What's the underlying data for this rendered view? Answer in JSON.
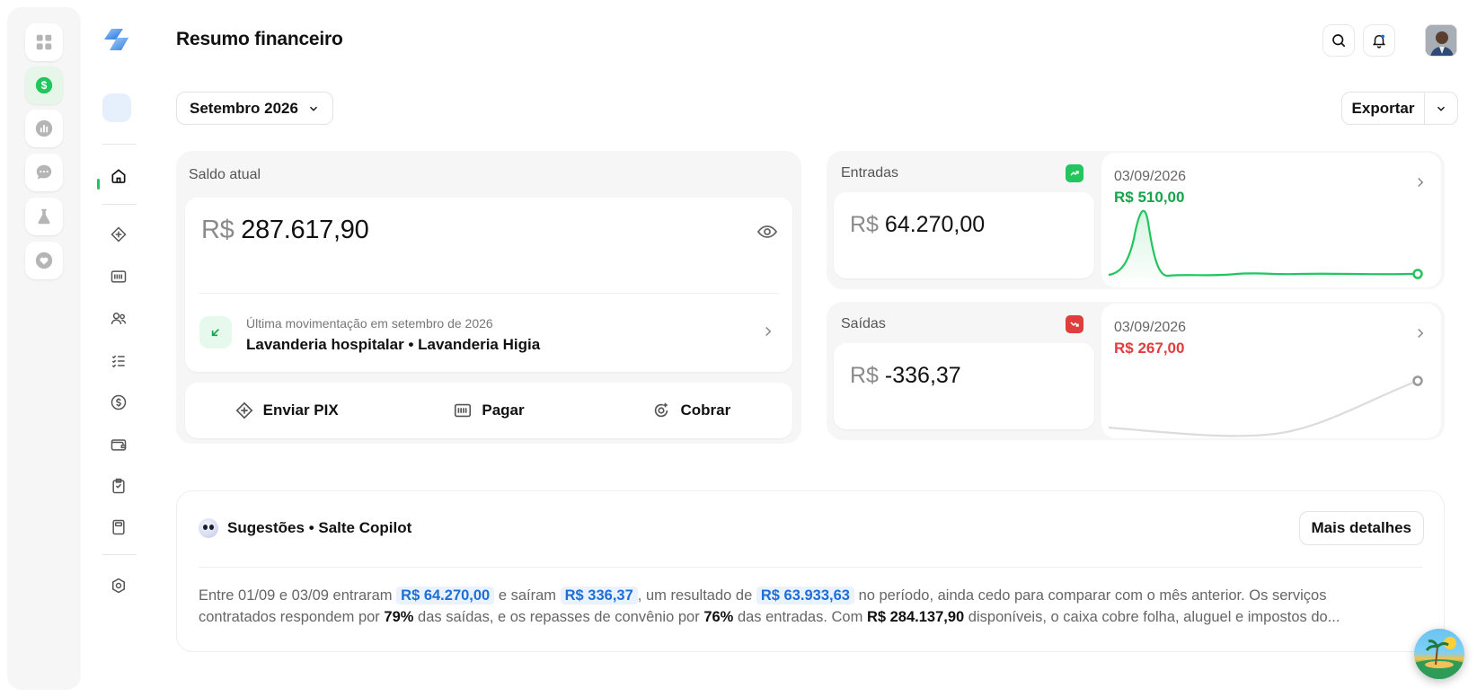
{
  "header": {
    "title": "Resumo financeiro"
  },
  "filters": {
    "month": "Setembro 2026",
    "export_label": "Exportar"
  },
  "balance": {
    "label": "Saldo atual",
    "currency": "R$",
    "amount": "287.617,90",
    "last_movement_caption": "Última movimentação em setembro de 2026",
    "last_movement": "Lavanderia hospitalar • Lavanderia Higia"
  },
  "actions": [
    {
      "label": "Enviar PIX",
      "icon": "pix-icon"
    },
    {
      "label": "Pagar",
      "icon": "barcode-icon"
    },
    {
      "label": "Cobrar",
      "icon": "charge-icon"
    }
  ],
  "inflows": {
    "label": "Entradas",
    "currency": "R$",
    "amount": "64.270,00",
    "date": "03/09/2026",
    "value": "R$ 510,00",
    "color": "#16a34a",
    "trend_icon": "trend-up-icon"
  },
  "outflows": {
    "label": "Saídas",
    "currency": "R$",
    "amount": "-336,37",
    "date": "03/09/2026",
    "value": "R$ 267,00",
    "color": "#e03e3e",
    "trend_icon": "trend-down-icon"
  },
  "suggestions": {
    "title": "Sugestões • Salte Copilot",
    "more_label": "Mais detalhes",
    "line1": {
      "t1": "Entre 01/09 e 03/09 entraram",
      "h1": "R$ 64.270,00",
      "t2": "e saíram",
      "h2": "R$ 336,37",
      "t3": ", um resultado de",
      "h3": "R$ 63.933,63",
      "t4": "no período, ainda cedo para comparar com o mês anterior. Os serviços"
    },
    "line2": {
      "t1": "contratados respondem por",
      "b1": "79%",
      "t2": "das saídas, e os repasses de convênio por",
      "b2": "76%",
      "t3": "das entradas. Com",
      "b3": "R$ 284.137,90",
      "t4": "disponíveis, o caixa cobre folha, aluguel e impostos do..."
    }
  },
  "colors": {
    "accent_green": "#22c55e",
    "highlight_blue": "#1d6fd6",
    "negative_red": "#e03e3e"
  }
}
